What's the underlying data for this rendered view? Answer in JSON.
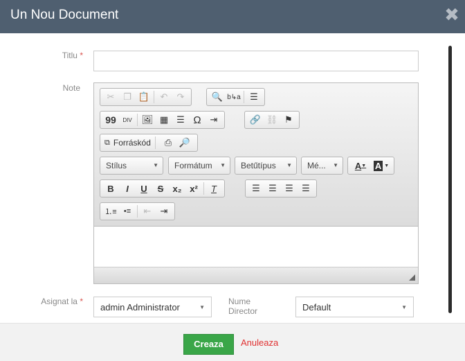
{
  "dialog": {
    "title": "Un Nou Document",
    "close_icon": "close-icon"
  },
  "form": {
    "title_label": "Titlu",
    "title_value": "",
    "note_label": "Note",
    "assigned_label": "Asignat la",
    "assigned_value": "admin Administrator",
    "director_label": "Nume Director",
    "director_value": "Default",
    "required_marker": "*"
  },
  "editor": {
    "source_label": "Forráskód",
    "style_combo": "Stílus",
    "format_combo": "Formátum",
    "font_combo": "Betűtípus",
    "size_combo": "Mé...",
    "bold": "B",
    "italic": "I",
    "underline": "U",
    "strike": "S",
    "subscript": "x₂",
    "superscript": "x²",
    "quote": "99",
    "div": "DIV",
    "omega": "Ω",
    "font_color": "A",
    "bg_color": "A"
  },
  "footer": {
    "create_label": "Creaza",
    "cancel_label": "Anuleaza"
  },
  "colors": {
    "header_bg": "#4f5f70",
    "create_bg": "#3aa648",
    "cancel_text": "#e03030"
  }
}
